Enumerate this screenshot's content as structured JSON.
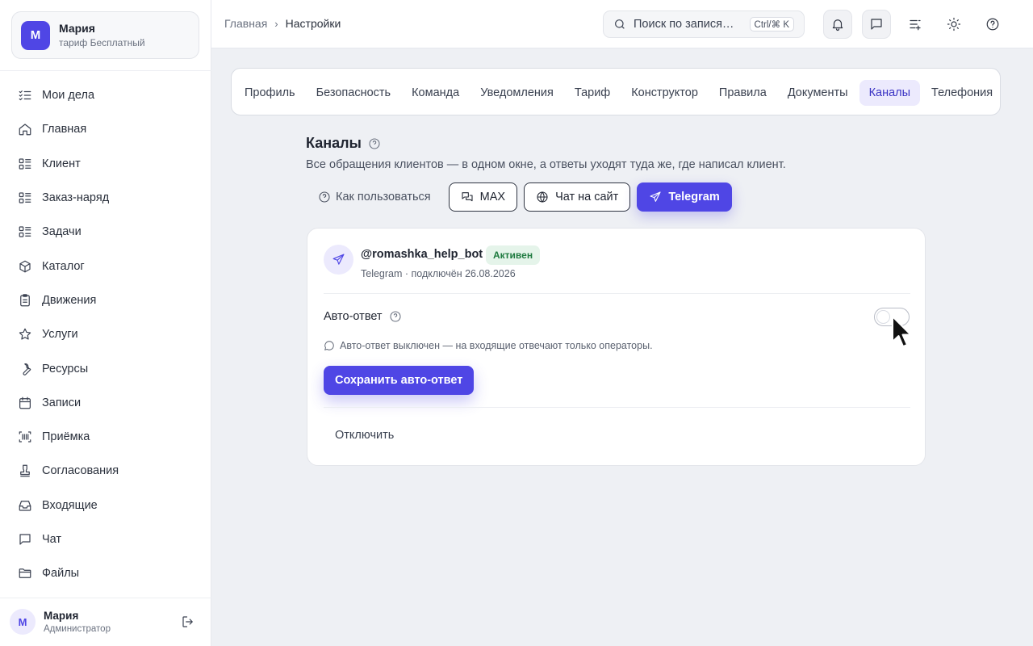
{
  "account": {
    "initial": "М",
    "name": "Мария",
    "plan": "тариф Бесплатный"
  },
  "sidebar": {
    "items": [
      {
        "label": "Мои дела",
        "icon": "checklist-icon"
      },
      {
        "label": "Главная",
        "icon": "home-icon"
      },
      {
        "label": "Клиент",
        "icon": "list-icon"
      },
      {
        "label": "Заказ-наряд",
        "icon": "list-icon"
      },
      {
        "label": "Задачи",
        "icon": "list-icon"
      },
      {
        "label": "Каталог",
        "icon": "box-icon"
      },
      {
        "label": "Движения",
        "icon": "clipboard-icon"
      },
      {
        "label": "Услуги",
        "icon": "star-icon"
      },
      {
        "label": "Ресурсы",
        "icon": "wrench-icon"
      },
      {
        "label": "Записи",
        "icon": "calendar-icon"
      },
      {
        "label": "Приёмка",
        "icon": "scan-icon"
      },
      {
        "label": "Согласования",
        "icon": "stamp-icon"
      },
      {
        "label": "Входящие",
        "icon": "inbox-icon"
      },
      {
        "label": "Чат",
        "icon": "chat-icon"
      },
      {
        "label": "Файлы",
        "icon": "folder-icon"
      }
    ]
  },
  "user": {
    "initial": "М",
    "name": "Мария",
    "role": "Администратор"
  },
  "breadcrumb": {
    "home": "Главная",
    "current": "Настройки"
  },
  "search": {
    "placeholder": "Поиск по записям...",
    "display": "Поиск по запися…",
    "shortcut": "Ctrl/⌘ K"
  },
  "tabs": [
    "Профиль",
    "Безопасность",
    "Команда",
    "Уведомления",
    "Тариф",
    "Конструктор",
    "Правила",
    "Документы",
    "Каналы",
    "Телефония"
  ],
  "active_tab": "Каналы",
  "page": {
    "title": "Каналы",
    "description": "Все обращения клиентов — в одном окне, а ответы уходят туда же, где написал клиент."
  },
  "channels": {
    "how_to": "Как пользоваться",
    "buttons": [
      "MAX",
      "Чат на сайт",
      "Telegram"
    ],
    "active": "Telegram"
  },
  "bot": {
    "name": "@romashka_help_bot",
    "status": "Активен",
    "meta": "Telegram · подключён 26.08.2026"
  },
  "auto_reply": {
    "label": "Авто-ответ",
    "enabled": false,
    "note": "Авто-ответ выключен — на входящие отвечают только операторы.",
    "save_label": "Сохранить авто-ответ"
  },
  "disconnect_label": "Отключить",
  "colors": {
    "accent": "#4f46e5",
    "badge_bg": "#e5f4ea",
    "badge_text": "#1e7a3f"
  }
}
